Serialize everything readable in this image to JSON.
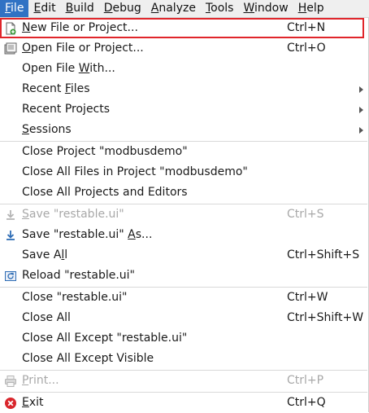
{
  "menubar": {
    "items": [
      {
        "label": "File",
        "u": "F",
        "rest": "ile"
      },
      {
        "label": "Edit",
        "u": "E",
        "rest": "dit"
      },
      {
        "label": "Build",
        "u": "B",
        "rest": "uild"
      },
      {
        "label": "Debug",
        "u": "D",
        "rest": "ebug"
      },
      {
        "label": "Analyze",
        "u": "A",
        "rest": "nalyze"
      },
      {
        "label": "Tools",
        "u": "T",
        "rest": "ools"
      },
      {
        "label": "Window",
        "u": "W",
        "rest": "indow"
      },
      {
        "label": "Help",
        "u": "H",
        "rest": "elp"
      }
    ]
  },
  "menu": {
    "new_file": {
      "pre": "",
      "u": "N",
      "post": "ew File or Project...",
      "shortcut": "Ctrl+N"
    },
    "open_file": {
      "pre": "",
      "u": "O",
      "post": "pen File or Project...",
      "shortcut": "Ctrl+O"
    },
    "open_with": {
      "pre": "Open File ",
      "u": "W",
      "post": "ith..."
    },
    "recent_files": {
      "pre": "Recent ",
      "u": "F",
      "post": "iles"
    },
    "recent_projects": {
      "pre": "Recent Pro",
      "u": "j",
      "post": "ects"
    },
    "sessions": {
      "pre": "",
      "u": "S",
      "post": "essions"
    },
    "close_project": {
      "label": "Close Project \"modbusdemo\""
    },
    "close_all_files_project": {
      "label": "Close All Files in Project \"modbusdemo\""
    },
    "close_all_projects": {
      "label": "Close All Projects and Editors"
    },
    "save": {
      "pre": "",
      "u": "S",
      "post": "ave \"restable.ui\"",
      "shortcut": "Ctrl+S"
    },
    "save_as": {
      "pre": "Save \"restable.ui\" ",
      "u": "A",
      "post": "s..."
    },
    "save_all": {
      "pre": "Save A",
      "u": "l",
      "post": "l",
      "shortcut": "Ctrl+Shift+S"
    },
    "reload": {
      "label": "Reload \"restable.ui\""
    },
    "close_file": {
      "label": "Close \"restable.ui\"",
      "shortcut": "Ctrl+W"
    },
    "close_all": {
      "label": "Close All",
      "shortcut": "Ctrl+Shift+W"
    },
    "close_all_except": {
      "label": "Close All Except \"restable.ui\""
    },
    "close_all_except_visible": {
      "label": "Close All Except Visible"
    },
    "print": {
      "pre": "",
      "u": "P",
      "post": "rint...",
      "shortcut": "Ctrl+P"
    },
    "exit": {
      "pre": "",
      "u": "E",
      "post": "xit",
      "shortcut": "Ctrl+Q"
    }
  },
  "colors": {
    "menubar_active": "#3072c4",
    "highlight_outline": "#e0262b",
    "disabled_text": "#a8a8a8"
  }
}
